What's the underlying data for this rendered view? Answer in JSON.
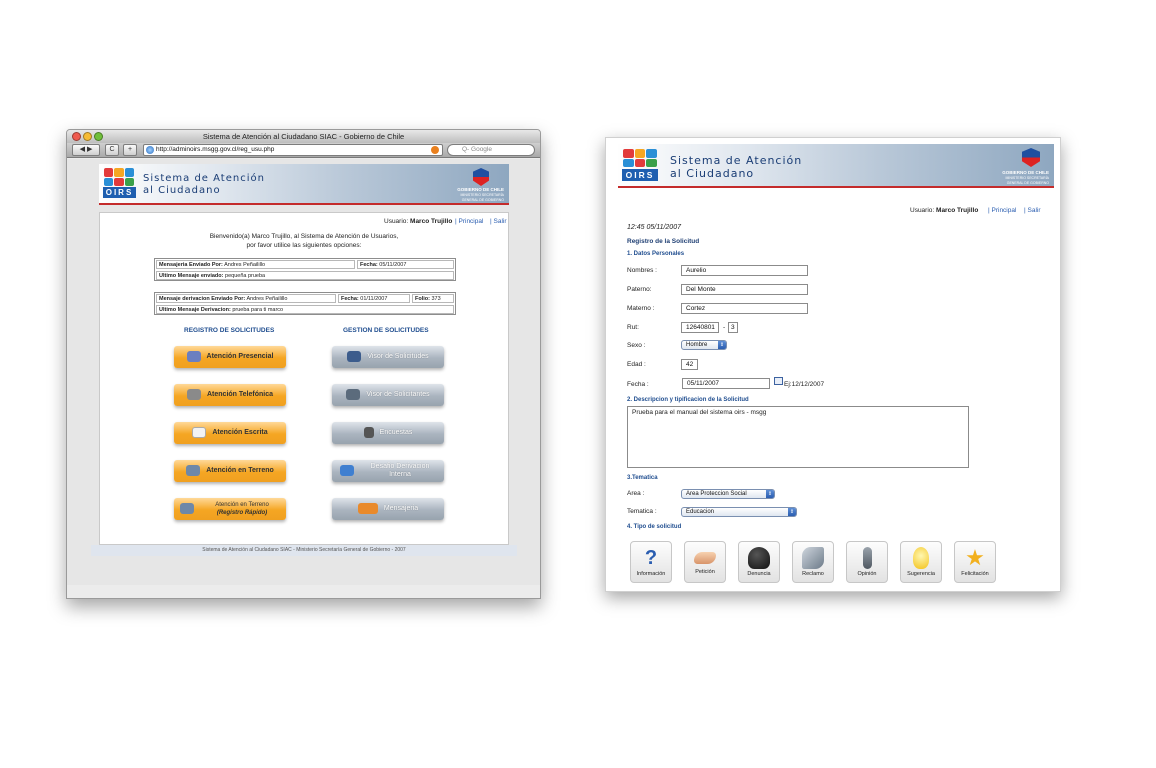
{
  "left_window": {
    "title": "Sistema de Atención al Ciudadano SIAC - Gobierno de Chile",
    "url": "http://adminoirs.msgg.gov.cl/reg_usu.php",
    "search_placeholder": "Q- Google",
    "banner": {
      "logo_text": "OIRS",
      "title_line1": "Sistema de Atención",
      "title_line2": "al Ciudadano",
      "gov_line1": "GOBIERNO DE CHILE",
      "gov_line2": "MINISTERIO SECRETARÍA",
      "gov_line3": "GENERAL DE GOBIERNO"
    },
    "user_label": "Usuario:",
    "user_name": "Marco Trujillo",
    "link_principal": "| Principal",
    "link_salir": "| Salir",
    "welcome_line1": "Bienvenido(a) Marco Trujillo, al Sistema de Atención de Usuarios,",
    "welcome_line2": "por favor utilice las siguientes opciones:",
    "box1": {
      "sent_by_label": "Mensajeria Enviado Por:",
      "sent_by": "Andres Peñailillo",
      "fecha_label": "Fecha:",
      "fecha": "05/11/2007",
      "last_label": "Ultimo Mensaje enviado:",
      "last": "pequeña prueba"
    },
    "box2": {
      "sent_by_label": "Mensaje derivacion Enviado Por:",
      "sent_by": "Andres Peñailillo",
      "fecha_label": "Fecha:",
      "fecha": "01/11/2007",
      "folio_label": "Folio:",
      "folio": "373",
      "last_label": "Ultimo Mensaje Derivacion:",
      "last": "prueba para ti marco"
    },
    "registro_header": "REGISTRO DE SOLICITUDES",
    "gestion_header": "GESTION DE SOLICITUDES",
    "registro_buttons": [
      "Atención Presencial",
      "Atención Telefónica",
      "Atención Escrita",
      "Atención en Terreno",
      "Atención en Terreno"
    ],
    "registro_sub": "(Registro Rápido)",
    "gestion_buttons": [
      "Visor de Solicitudes",
      "Visor de Solicitantes",
      "Encuestas",
      "Desafio Derivacion",
      "Mensajeria"
    ],
    "gestion_sub": "Interna",
    "footer": "Sistema de Atención al Ciudadano SIAC - Ministerio Secretaría General de Gobierno - 2007"
  },
  "right_window": {
    "banner": {
      "logo_text": "OIRS",
      "title_line1": "Sistema de Atención",
      "title_line2": "al Ciudadano",
      "gov_line1": "GOBIERNO DE CHILE",
      "gov_line2": "MINISTERIO SECRETARÍA",
      "gov_line3": "GENERAL DE GOBIERNO"
    },
    "user_label": "Usuario:",
    "user_name": "Marco Trujillo",
    "link_principal": "| Principal",
    "link_salir": "| Salir",
    "timestamp": "12:45 05/11/2007",
    "form_title": "Registro de la Solicitud",
    "section1": "1. Datos Personales",
    "nombres_label": "Nombres :",
    "nombres": "Aurelio",
    "paterno_label": "Paterno:",
    "paterno": "Del Monte",
    "materno_label": "Materno :",
    "materno": "Cortez",
    "rut_label": "Rut:",
    "rut": "12640801",
    "rut_dash": "-",
    "rut_dv": "3",
    "sexo_label": "Sexo :",
    "sexo": "Hombre",
    "edad_label": "Edad :",
    "edad": "42",
    "fecha_label": "Fecha :",
    "fecha": "05/11/2007",
    "fecha_example": "Ej:12/12/2007",
    "section2": "2. Descripcion y tipificacion de la Solicitud",
    "descripcion": "Prueba para el manual del sistema oirs - msgg",
    "section3": "3.Tematica",
    "area_label": "Area :",
    "area": "Area Proteccion Social",
    "tematica_label": "Tematica :",
    "tematica": "Educacion",
    "section4": "4. Tipo de solicitud",
    "tipos": [
      "Información",
      "Petición",
      "Denuncia",
      "Reclamo",
      "Opinión",
      "Sugerencia",
      "Felicitación"
    ]
  },
  "colors": {
    "banner_blue": "#1a3d75",
    "link_blue": "#2a5db0",
    "orange_button": "#f5a623",
    "gray_button": "#aab4bf",
    "flag_red": "#d22222"
  }
}
